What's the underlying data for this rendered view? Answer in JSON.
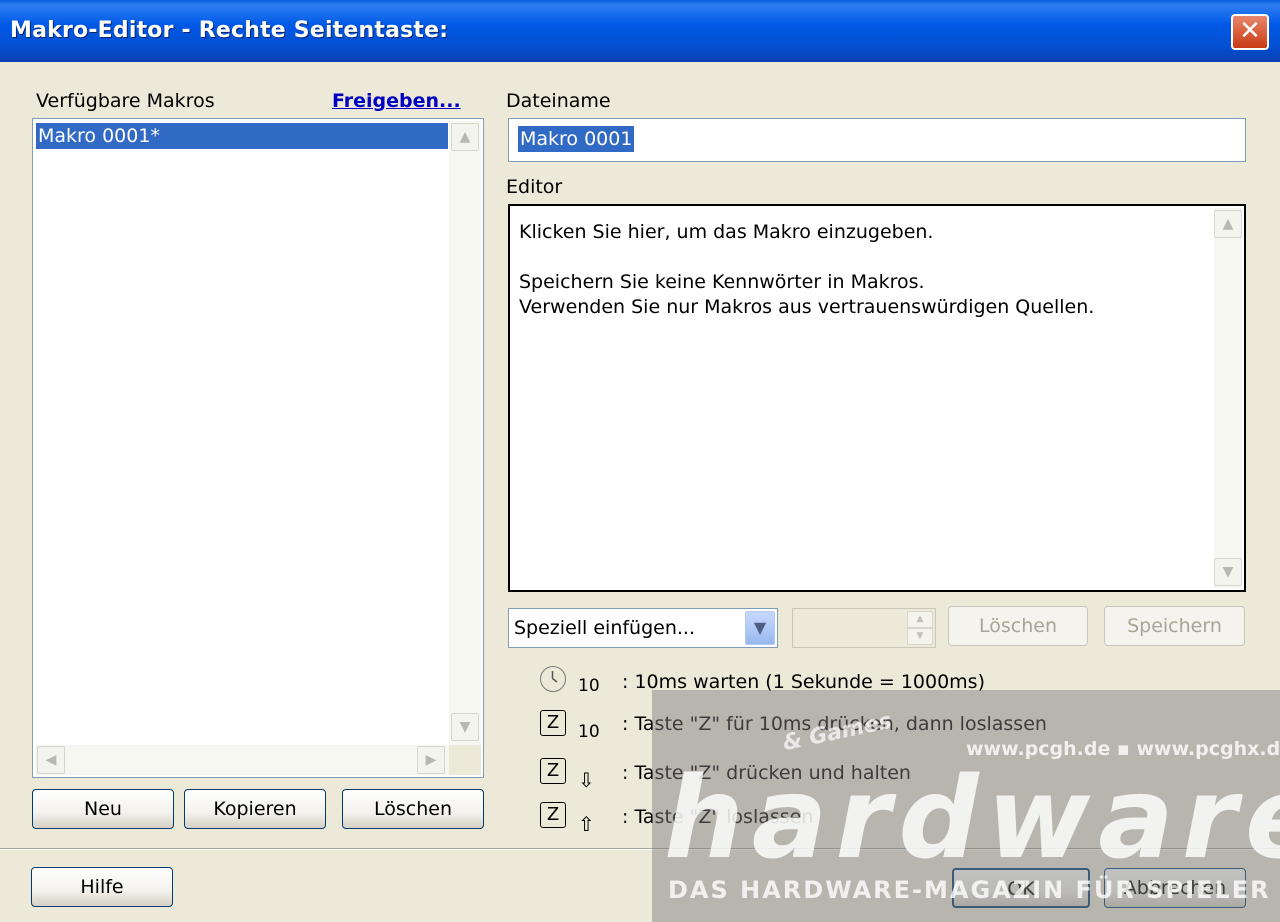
{
  "window": {
    "title": "Makro-Editor - Rechte Seitentaste:",
    "close_glyph": "✕"
  },
  "macros": {
    "label": "Verfügbare Makros",
    "share_link": "Freigeben...",
    "items": [
      {
        "label": "Makro 0001*",
        "selected": true
      }
    ],
    "buttons": {
      "new": "Neu",
      "copy": "Kopieren",
      "delete": "Löschen"
    }
  },
  "filename": {
    "label": "Dateiname",
    "value": "Makro 0001"
  },
  "editor": {
    "label": "Editor",
    "content": "Klicken Sie hier, um das Makro einzugeben.\n\nSpeichern Sie keine Kennwörter in Makros.\nVerwenden Sie nur Makros aus vertrauenswürdigen Quellen."
  },
  "insert": {
    "combo_value": "Speziell einfügen...",
    "spinner_value": "",
    "delete_label": "Löschen",
    "save_label": "Speichern"
  },
  "legend": [
    {
      "icon": "clock-icon",
      "sub": "10",
      "text": ": 10ms warten (1 Sekunde = 1000ms)"
    },
    {
      "icon": "key-z-icon",
      "key": "Z",
      "sub": "10",
      "text": ": Taste \"Z\" für 10ms drücken, dann loslassen"
    },
    {
      "icon": "key-z-icon",
      "key": "Z",
      "arrow": "⇩",
      "text": ": Taste \"Z\" drücken und halten"
    },
    {
      "icon": "key-z-icon",
      "key": "Z",
      "arrow": "⇧",
      "text": ": Taste \"Z\" loslassen"
    }
  ],
  "footer": {
    "help_label": "Hilfe",
    "ok_label": "OK",
    "cancel_label": "Abbrechen"
  },
  "watermark": {
    "url": "www.pcgh.de ▪ www.pcghx.de",
    "logo": "hardware",
    "small": "& Games",
    "tagline": "DAS HARDWARE-MAGAZIN FÜR SPIELER"
  },
  "colors": {
    "title_bar": "#0058e6",
    "selection": "#316ac5",
    "dialog_bg": "#ECE9D8",
    "link": "#0000c0"
  }
}
